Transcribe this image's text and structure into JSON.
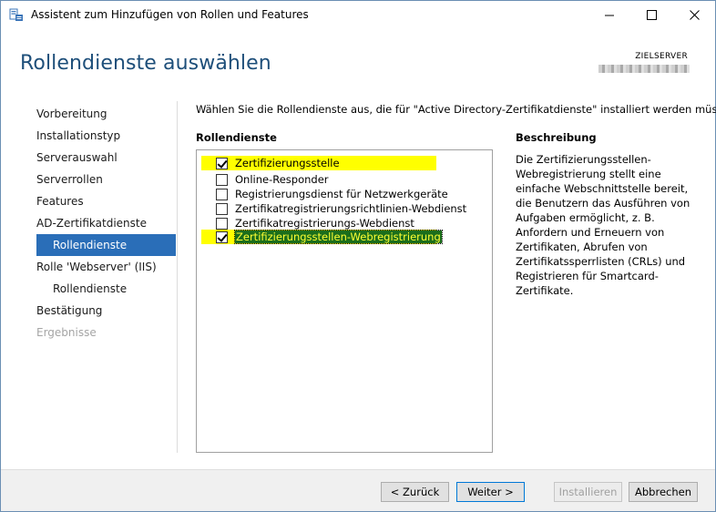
{
  "window": {
    "title": "Assistent zum Hinzufügen von Rollen und Features",
    "controls": {
      "minimize": "—",
      "maximize": "☐",
      "close": "✕"
    }
  },
  "header": {
    "page_title": "Rollendienste auswählen",
    "server_label": "ZIELSERVER"
  },
  "nav": {
    "items": [
      {
        "label": "Vorbereitung",
        "state": "normal"
      },
      {
        "label": "Installationstyp",
        "state": "normal"
      },
      {
        "label": "Serverauswahl",
        "state": "normal"
      },
      {
        "label": "Serverrollen",
        "state": "normal"
      },
      {
        "label": "Features",
        "state": "normal"
      },
      {
        "label": "AD-Zertifikatdienste",
        "state": "normal"
      },
      {
        "label": "Rollendienste",
        "state": "active"
      },
      {
        "label": "Rolle 'Webserver' (IIS)",
        "state": "normal"
      },
      {
        "label": "Rollendienste",
        "state": "sub"
      },
      {
        "label": "Bestätigung",
        "state": "normal"
      },
      {
        "label": "Ergebnisse",
        "state": "disabled"
      }
    ]
  },
  "main": {
    "instruction": "Wählen Sie die Rollendienste aus, die für \"Active Directory-Zertifikatdienste\" installiert werden müssen.",
    "roles_header": "Rollendienste",
    "description_header": "Beschreibung",
    "roles": [
      {
        "label": "Zertifizierungsstelle",
        "checked": true,
        "highlighted": true
      },
      {
        "label": "Online-Responder",
        "checked": false,
        "highlighted": false
      },
      {
        "label": "Registrierungsdienst für Netzwerkgeräte",
        "checked": false,
        "highlighted": false
      },
      {
        "label": "Zertifikatregistrierungsrichtlinien-Webdienst",
        "checked": false,
        "highlighted": false
      },
      {
        "label": "Zertifikatregistrierungs-Webdienst",
        "checked": false,
        "highlighted": false
      },
      {
        "label": "Zertifizierungsstellen-Webregistrierung",
        "checked": true,
        "highlighted": true,
        "selected": true
      }
    ],
    "description": "Die Zertifizierungsstellen-Webregistrierung stellt eine einfache Webschnittstelle bereit, die Benutzern das Ausführen von Aufgaben ermöglicht, z. B. Anfordern und Erneuern von Zertifikaten, Abrufen von Zertifikatssperrlisten (CRLs) und Registrieren für Smartcard-Zertifikate."
  },
  "footer": {
    "back_label": "< Zurück",
    "next_label": "Weiter >",
    "install_label": "Installieren",
    "cancel_label": "Abbrechen"
  },
  "colors": {
    "accent": "#2a6eb8",
    "title": "#1e4f7a",
    "highlight": "#ffff00",
    "selection": "#1b6e1b"
  }
}
